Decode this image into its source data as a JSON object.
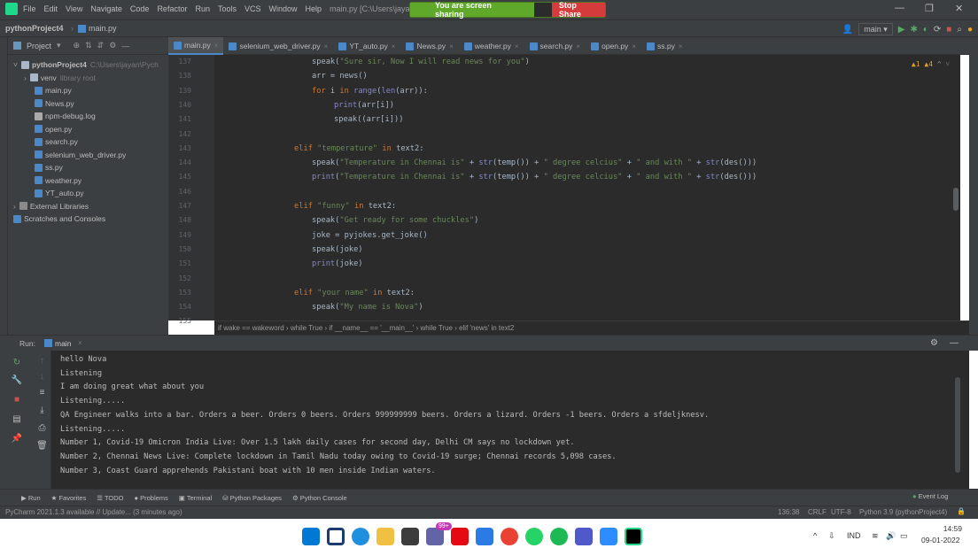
{
  "menubar": {
    "items": [
      "File",
      "Edit",
      "View",
      "Navigate",
      "Code",
      "Refactor",
      "Run",
      "Tools",
      "VCS",
      "Window",
      "Help"
    ],
    "window_title": "main.py [C:\\Users\\jayan\\"
  },
  "share": {
    "status": "You are screen sharing",
    "stop_label": "Stop Share"
  },
  "nav": {
    "project": "pythonProject4",
    "file": "main.py",
    "branch": "main"
  },
  "project_panel": {
    "title": "Project",
    "items": [
      {
        "label": "pythonProject4",
        "hint": "C:\\Users\\jayan\\Pych",
        "depth": 0,
        "type": "folder"
      },
      {
        "label": "venv",
        "hint": "library root",
        "depth": 1,
        "type": "folder"
      },
      {
        "label": "main.py",
        "depth": 2,
        "type": "py"
      },
      {
        "label": "News.py",
        "depth": 2,
        "type": "py"
      },
      {
        "label": "npm-debug.log",
        "depth": 2,
        "type": "log"
      },
      {
        "label": "open.py",
        "depth": 2,
        "type": "py"
      },
      {
        "label": "search.py",
        "depth": 2,
        "type": "py"
      },
      {
        "label": "selenium_web_driver.py",
        "depth": 2,
        "type": "py"
      },
      {
        "label": "ss.py",
        "depth": 2,
        "type": "py"
      },
      {
        "label": "weather.py",
        "depth": 2,
        "type": "py"
      },
      {
        "label": "YT_auto.py",
        "depth": 2,
        "type": "py"
      },
      {
        "label": "External Libraries",
        "depth": 0,
        "type": "lib"
      },
      {
        "label": "Scratches and Consoles",
        "depth": 0,
        "type": "scratch"
      }
    ]
  },
  "editor_tabs": [
    "main.py",
    "selenium_web_driver.py",
    "YT_auto.py",
    "News.py",
    "weather.py",
    "search.py",
    "open.py",
    "ss.py"
  ],
  "line_numbers": [
    "137",
    "138",
    "139",
    "140",
    "141",
    "142",
    "143",
    "144",
    "145",
    "146",
    "147",
    "148",
    "149",
    "150",
    "151",
    "152",
    "153",
    "154",
    "155"
  ],
  "inspection": "▲1 ▲4",
  "editor_breadcrumb": "if wake == wakeword  ›  while True  ›  if __name__ == '__main__'  ›  while True  ›  elif 'news' in text2",
  "run": {
    "label": "Run:",
    "config": "main",
    "output": [
      "hello Nova",
      "Listening",
      "I am doing great what about you",
      "Listening.....",
      "QA Engineer walks into a bar. Orders a beer. Orders 0 beers. Orders 999999999 beers. Orders a lizard. Orders -1 beers. Orders a sfdeljknesv.",
      "Listening.....",
      "Number 1, Covid-19 Omicron India Live: Over 1.5 lakh daily cases for second day, Delhi CM says no lockdown yet.",
      "Number 2, Chennai News Live: Complete lockdown in Tamil Nadu today owing to Covid-19 surge; Chennai records 5,098 cases.",
      "Number 3, Coast Guard apprehends Pakistani boat with 10 men inside Indian waters."
    ]
  },
  "bottom_tabs": [
    "Run",
    "Favorites",
    "TODO",
    "Problems",
    "Terminal",
    "Python Packages",
    "Python Console"
  ],
  "event_log": "Event Log",
  "status": {
    "message": "PyCharm 2021.1.3 available // Update... (3 minutes ago)",
    "position": "136:38",
    "line_sep": "CRLF",
    "encoding": "UTF-8",
    "interpreter": "Python 3.9 (pythonProject4)"
  },
  "taskbar": {
    "lang": "IND",
    "time": "14:59",
    "date": "09-01-2022",
    "badge": "99+"
  }
}
